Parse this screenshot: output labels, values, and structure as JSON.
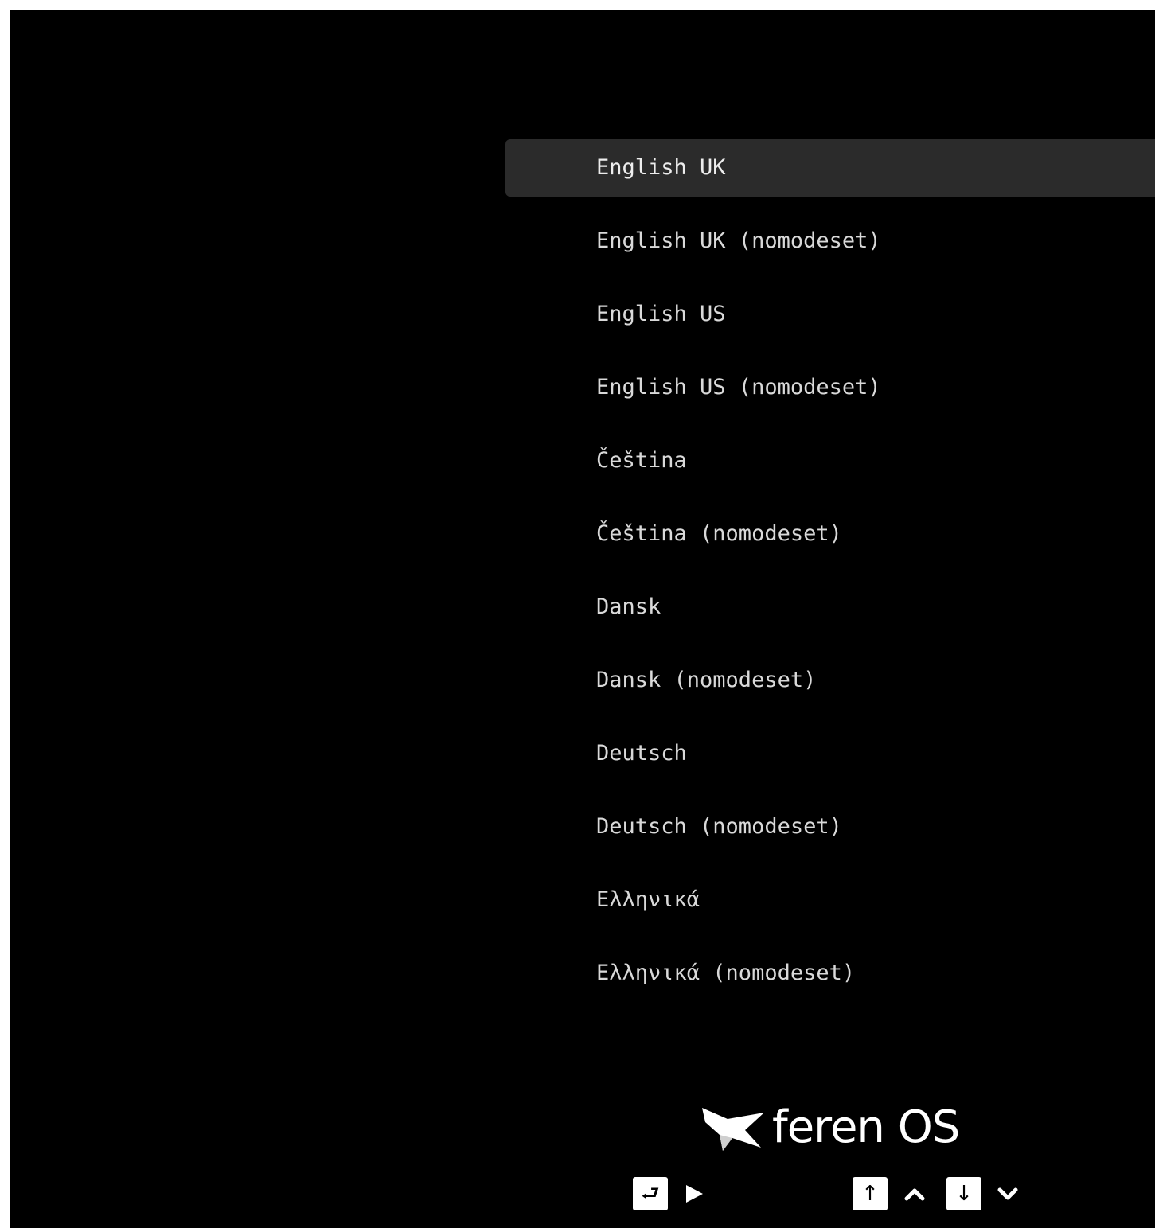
{
  "menu": {
    "selected_index": 0,
    "items": [
      {
        "label": "English UK"
      },
      {
        "label": "English UK (nomodeset)"
      },
      {
        "label": "English US"
      },
      {
        "label": "English US (nomodeset)"
      },
      {
        "label": "Čeština"
      },
      {
        "label": "Čeština (nomodeset)"
      },
      {
        "label": "Dansk"
      },
      {
        "label": "Dansk (nomodeset)"
      },
      {
        "label": "Deutsch"
      },
      {
        "label": "Deutsch (nomodeset)"
      },
      {
        "label": "Ελληνικά"
      },
      {
        "label": "Ελληνικά (nomodeset)"
      }
    ]
  },
  "branding": {
    "logo_icon": "feren-bird-icon",
    "logo_text": "feren OS"
  },
  "hints": {
    "enter_key": "⮐",
    "enter_action_icon": "play-icon",
    "up_key": "↑",
    "up_action_icon": "chevron-up-icon",
    "down_key": "↓",
    "down_action_icon": "chevron-down-icon"
  },
  "colors": {
    "background": "#000000",
    "selection": "#2b2b2b",
    "text": "#d9d9d9",
    "key_background": "#ffffff"
  }
}
